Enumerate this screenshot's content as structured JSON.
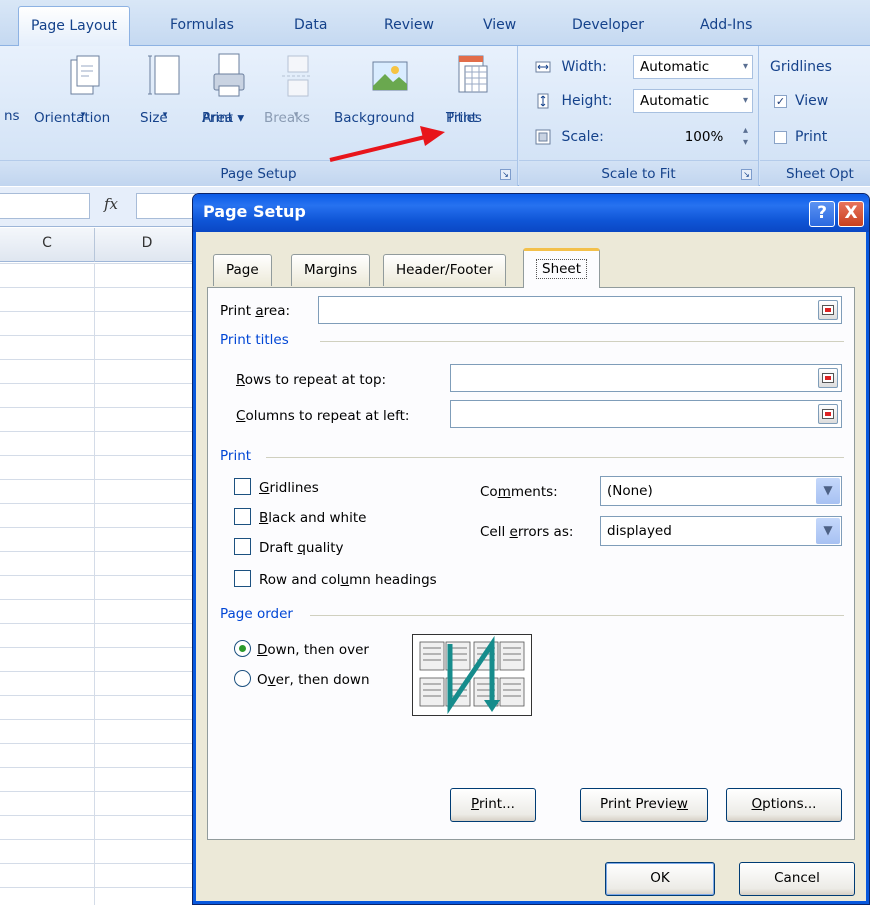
{
  "ribbon": {
    "tabs": [
      "Page Layout",
      "Formulas",
      "Data",
      "Review",
      "View",
      "Developer",
      "Add-Ins"
    ],
    "active_tab": "Page Layout",
    "page_setup": {
      "group_label": "Page Setup",
      "buttons": {
        "margins_partial": "ns",
        "orientation": "Orientation",
        "size": "Size",
        "print_area": [
          "Print",
          "Area"
        ],
        "breaks": "Breaks",
        "background": "Background",
        "print_titles": [
          "Print",
          "Titles"
        ]
      }
    },
    "scale_to_fit": {
      "group_label": "Scale to Fit",
      "width_label": "Width:",
      "width_value": "Automatic",
      "height_label": "Height:",
      "height_value": "Automatic",
      "scale_label": "Scale:",
      "scale_value": "100%"
    },
    "sheet_options": {
      "group_label": "Sheet Opt",
      "gridlines_label": "Gridlines",
      "view_label": "View",
      "print_label": "Print",
      "view_checked": true,
      "print_checked": false
    }
  },
  "formula_bar": {
    "fx_label": "fx"
  },
  "sheet": {
    "columns": [
      "C",
      "D"
    ]
  },
  "dialog": {
    "title": "Page Setup",
    "help_symbol": "?",
    "close_symbol": "X",
    "tabs": [
      "Page",
      "Margins",
      "Header/Footer",
      "Sheet"
    ],
    "active_tab": "Sheet",
    "print_area": {
      "label_pre": "Print ",
      "label_ul": "a",
      "label_post": "rea:",
      "value": ""
    },
    "print_titles": {
      "section": "Print titles",
      "rows_ul": "R",
      "rows_rest": "ows to repeat at top:",
      "rows_value": "",
      "cols_ul": "C",
      "cols_rest": "olumns to repeat at left:",
      "cols_value": ""
    },
    "print": {
      "section": "Print",
      "gridlines": {
        "ul": "G",
        "rest": "ridlines",
        "checked": false
      },
      "black_white": {
        "ul": "B",
        "rest": "lack and white",
        "checked": false
      },
      "draft": {
        "pre": "Draft ",
        "ul": "q",
        "post": "uality",
        "checked": false
      },
      "row_col": {
        "pre": "Row and col",
        "ul": "u",
        "post": "mn headings",
        "checked": false
      },
      "comments": {
        "pre": "Co",
        "ul": "m",
        "post": "ments:",
        "value": "(None)"
      },
      "cell_errors": {
        "pre": "Cell ",
        "ul": "e",
        "post": "rrors as:",
        "value": "displayed"
      }
    },
    "page_order": {
      "section": "Page order",
      "down_over": {
        "ul": "D",
        "rest": "own, then over",
        "selected": true
      },
      "over_down": {
        "pre": "O",
        "ul": "v",
        "post": "er, then down",
        "selected": false
      }
    },
    "buttons": {
      "print": {
        "ul": "P",
        "rest": "rint..."
      },
      "preview": {
        "pre": "Print Previe",
        "ul": "w",
        "post": ""
      },
      "options": {
        "ul": "O",
        "rest": "ptions..."
      },
      "ok": "OK",
      "cancel": "Cancel"
    }
  }
}
